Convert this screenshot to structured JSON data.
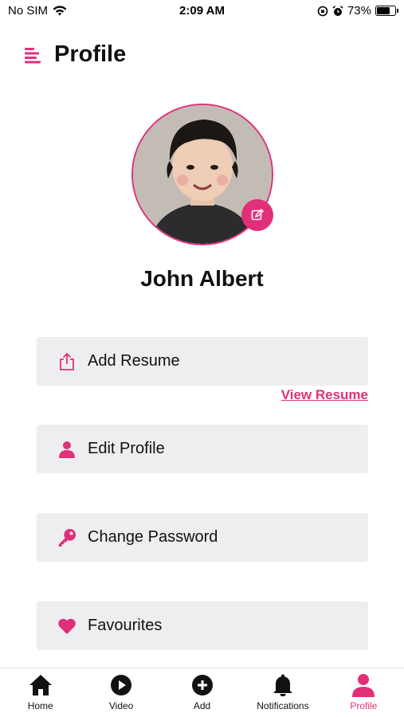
{
  "status_bar": {
    "carrier": "No SIM",
    "time": "2:09 AM",
    "battery_percent": "73%",
    "battery_level": 0.73
  },
  "header": {
    "title": "Profile",
    "menu_icon": "menu-icon"
  },
  "profile": {
    "name": "John Albert",
    "edit_icon": "edit-icon"
  },
  "menu": {
    "items": [
      {
        "label": "Add Resume",
        "icon": "share-upload-icon"
      },
      {
        "label": "Edit Profile",
        "icon": "person-icon"
      },
      {
        "label": "Change Password",
        "icon": "key-icon"
      },
      {
        "label": "Favourites",
        "icon": "heart-icon"
      }
    ],
    "view_resume_link": "View Resume"
  },
  "bottom_nav": {
    "items": [
      {
        "label": "Home",
        "icon": "home-icon"
      },
      {
        "label": "Video",
        "icon": "play-icon"
      },
      {
        "label": "Add",
        "icon": "add-icon"
      },
      {
        "label": "Notifications",
        "icon": "bell-icon"
      },
      {
        "label": "Profile",
        "icon": "person-icon",
        "active": true
      }
    ]
  },
  "colors": {
    "accent": "#e0307a",
    "card_bg": "#eeeef1"
  }
}
